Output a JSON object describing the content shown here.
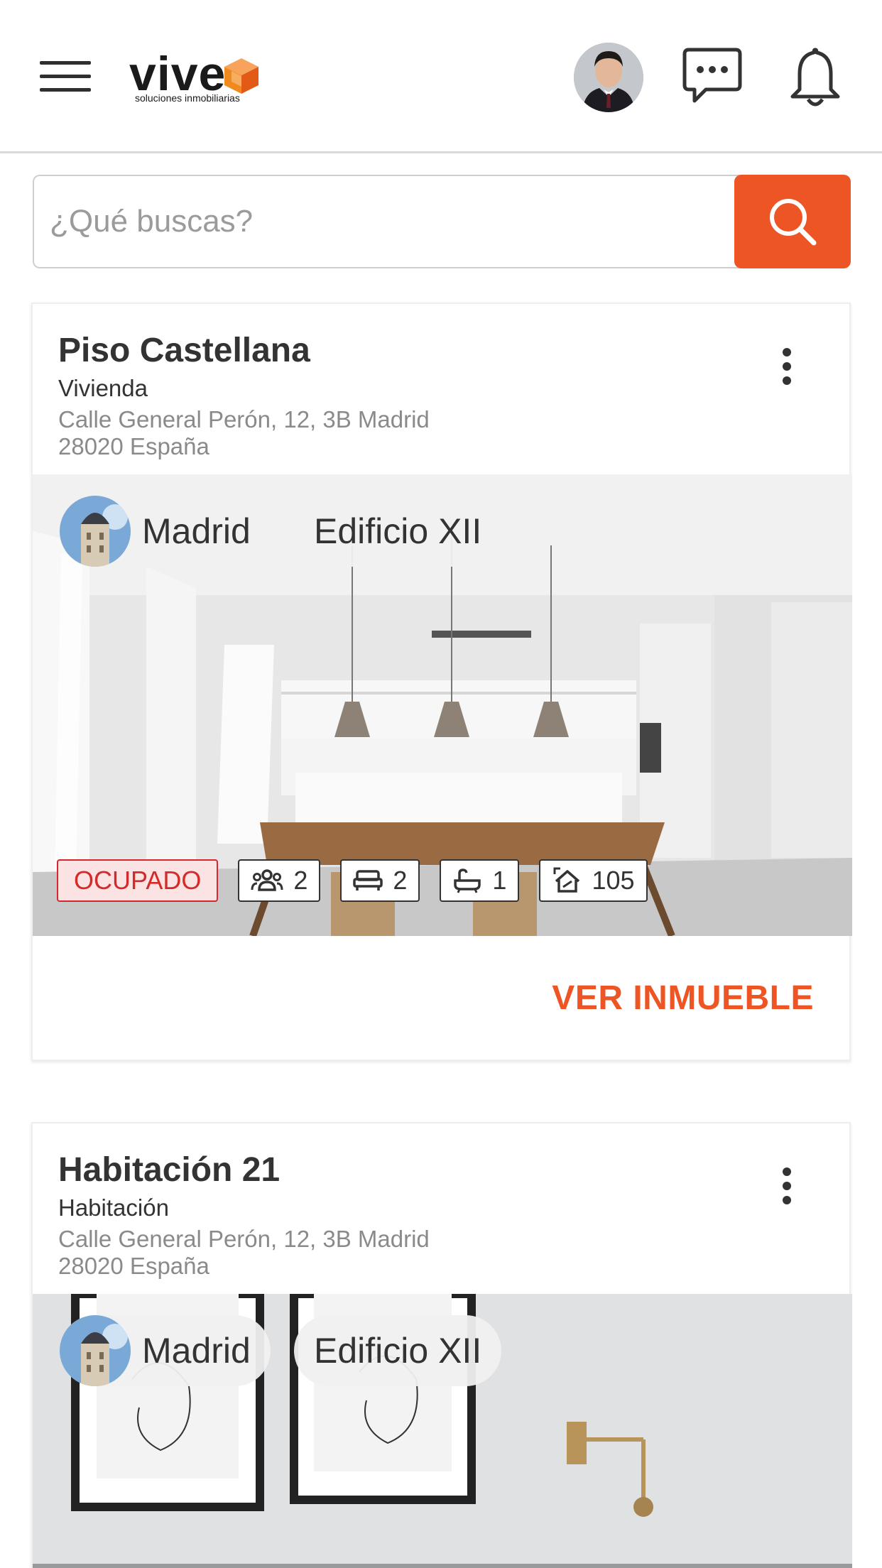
{
  "header": {
    "logo_word": "vive",
    "logo_tagline": "soluciones inmobiliarias"
  },
  "search": {
    "placeholder": "¿Qué buscas?"
  },
  "colors": {
    "accent": "#ee5524",
    "status_red": "#d8262e"
  },
  "icons": [
    "menu-icon",
    "chat-icon",
    "bell-icon",
    "search-icon",
    "more-vert-icon",
    "people-icon",
    "bed-icon",
    "bathtub-icon",
    "area-icon"
  ],
  "cards": [
    {
      "title": "Piso Castellana",
      "type": "Vivienda",
      "address_line1": "Calle General Perón, 12, 3B Madrid",
      "address_line2": "28020 España",
      "city_chip": "Madrid",
      "building_chip": "Edificio XII",
      "status": "OCUPADO",
      "occupants": "2",
      "bedrooms": "2",
      "bathrooms": "1",
      "area": "105",
      "cta": "VER INMUEBLE"
    },
    {
      "title": "Habitación 21",
      "type": "Habitación",
      "address_line1": "Calle General Perón, 12, 3B Madrid",
      "address_line2": "28020 España",
      "city_chip": "Madrid",
      "building_chip": "Edificio XII"
    }
  ]
}
